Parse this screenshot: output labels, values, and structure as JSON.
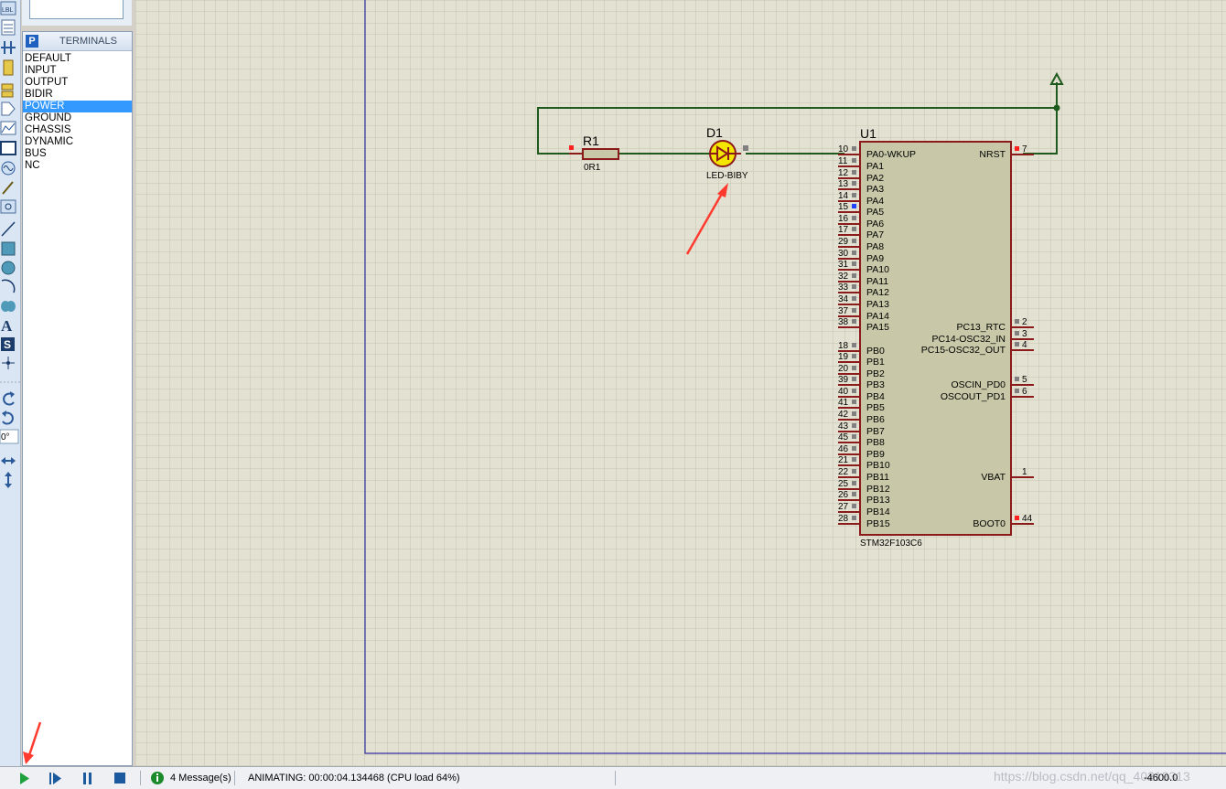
{
  "panel": {
    "title": "TERMINALS",
    "badge": "P",
    "items": [
      "DEFAULT",
      "INPUT",
      "OUTPUT",
      "BIDIR",
      "POWER",
      "GROUND",
      "CHASSIS",
      "DYNAMIC",
      "BUS",
      "NC"
    ],
    "selected_index": 4
  },
  "toolbar": {
    "rotation_value": "0°"
  },
  "schematic": {
    "resistor": {
      "ref": "R1",
      "value": "0R1"
    },
    "led": {
      "ref": "D1",
      "value": "LED-BIBY"
    },
    "mcu": {
      "ref": "U1",
      "part": "STM32F103C6",
      "left_pins": [
        {
          "num": "10",
          "name": "PA0-WKUP"
        },
        {
          "num": "11",
          "name": "PA1"
        },
        {
          "num": "12",
          "name": "PA2"
        },
        {
          "num": "13",
          "name": "PA3"
        },
        {
          "num": "14",
          "name": "PA4"
        },
        {
          "num": "15",
          "name": "PA5"
        },
        {
          "num": "16",
          "name": "PA6"
        },
        {
          "num": "17",
          "name": "PA7"
        },
        {
          "num": "29",
          "name": "PA8"
        },
        {
          "num": "30",
          "name": "PA9"
        },
        {
          "num": "31",
          "name": "PA10"
        },
        {
          "num": "32",
          "name": "PA11"
        },
        {
          "num": "33",
          "name": "PA12"
        },
        {
          "num": "34",
          "name": "PA13"
        },
        {
          "num": "37",
          "name": "PA14"
        },
        {
          "num": "38",
          "name": "PA15"
        },
        {
          "num": "18",
          "name": "PB0"
        },
        {
          "num": "19",
          "name": "PB1"
        },
        {
          "num": "20",
          "name": "PB2"
        },
        {
          "num": "39",
          "name": "PB3"
        },
        {
          "num": "40",
          "name": "PB4"
        },
        {
          "num": "41",
          "name": "PB5"
        },
        {
          "num": "42",
          "name": "PB6"
        },
        {
          "num": "43",
          "name": "PB7"
        },
        {
          "num": "45",
          "name": "PB8"
        },
        {
          "num": "46",
          "name": "PB9"
        },
        {
          "num": "21",
          "name": "PB10"
        },
        {
          "num": "22",
          "name": "PB11"
        },
        {
          "num": "25",
          "name": "PB12"
        },
        {
          "num": "26",
          "name": "PB13"
        },
        {
          "num": "27",
          "name": "PB14"
        },
        {
          "num": "28",
          "name": "PB15"
        }
      ],
      "right_pins": [
        {
          "num": "7",
          "name": "NRST"
        },
        {
          "num": "2",
          "name": "PC13_RTC"
        },
        {
          "num": "3",
          "name": "PC14-OSC32_IN"
        },
        {
          "num": "4",
          "name": "PC15-OSC32_OUT"
        },
        {
          "num": "5",
          "name": "OSCIN_PD0"
        },
        {
          "num": "6",
          "name": "OSCOUT_PD1"
        },
        {
          "num": "1",
          "name": "VBAT"
        },
        {
          "num": "44",
          "name": "BOOT0"
        }
      ]
    }
  },
  "status": {
    "messages": "4 Message(s)",
    "animating": "ANIMATING: 00:00:04.134468 (CPU load 64%)",
    "coord": "-4600.0",
    "watermark": "https://blog.csdn.net/qq_40219313"
  },
  "colors": {
    "grid_bg": "#e3e2d2",
    "grid_line": "#c6c4b2",
    "wire": "#1e5a1e",
    "component": "#8b1a1a",
    "chip_fill": "#c8c8a8",
    "led_fill": "#f5e600",
    "arrow": "#ff3b30",
    "sheet_border": "#3232a0"
  }
}
